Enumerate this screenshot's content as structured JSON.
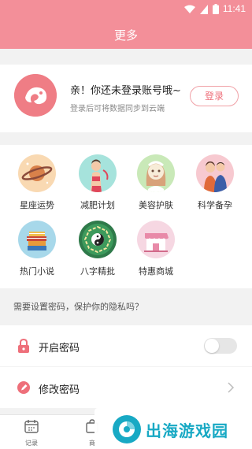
{
  "status_bar": {
    "time": "11:41"
  },
  "header": {
    "title": "更多"
  },
  "login": {
    "title": "亲！你还未登录账号哦~",
    "subtitle": "登录后可将数据同步到云端",
    "button_label": "登录"
  },
  "grid": {
    "items": [
      {
        "label": "星座运势",
        "icon": "saturn-icon"
      },
      {
        "label": "减肥计划",
        "icon": "slim-woman-icon"
      },
      {
        "label": "美容护肤",
        "icon": "face-mask-icon"
      },
      {
        "label": "科学备孕",
        "icon": "couple-icon"
      },
      {
        "label": "热门小说",
        "icon": "books-icon"
      },
      {
        "label": "八字精批",
        "icon": "bagua-icon"
      },
      {
        "label": "特惠商城",
        "icon": "shop-icon"
      }
    ]
  },
  "password": {
    "hint": "需要设置密码，保护你的隐私吗？",
    "enable_label": "开启密码",
    "enable_on": false,
    "change_label": "修改密码"
  },
  "bottom_nav": {
    "items": [
      {
        "label": "记录",
        "icon": "calendar-icon"
      },
      {
        "label": "商",
        "icon": "bag-icon"
      }
    ]
  },
  "watermark": {
    "text": "出海游戏园"
  },
  "colors": {
    "primary": "#f38f99",
    "accent": "#ee6f7a",
    "watermark": "#18a9c4"
  }
}
